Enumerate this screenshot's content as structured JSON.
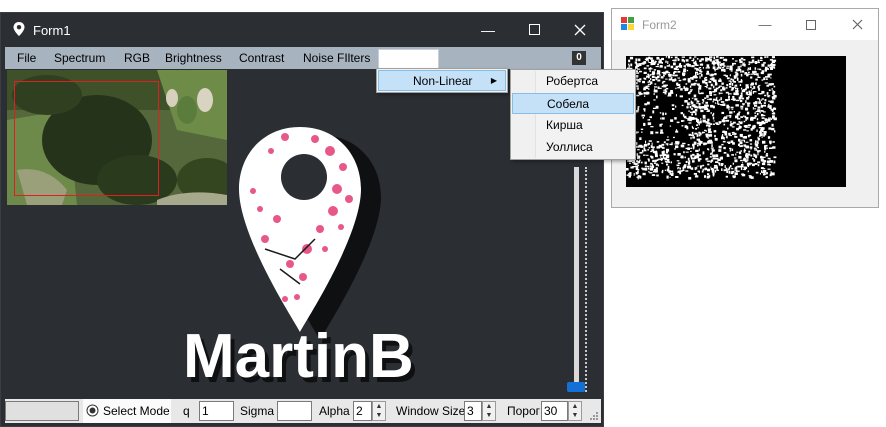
{
  "form1": {
    "title": "Form1",
    "controls": {
      "minimize": "minimize-icon",
      "maximize": "maximize-icon",
      "close": "close-icon"
    },
    "menu": [
      {
        "label": "File"
      },
      {
        "label": "Spectrum"
      },
      {
        "label": "RGB"
      },
      {
        "label": "Brightness"
      },
      {
        "label": "Contrast"
      },
      {
        "label": "Noise FIlters"
      }
    ],
    "menu_counter": "0",
    "logo_text": "MartinB",
    "statusbar": {
      "radio_label": "Select Mode",
      "q_label": "q",
      "q_value": "1",
      "sigma_label": "Sigma",
      "sigma_value": "",
      "alpha_label": "Alpha",
      "alpha_value": "2",
      "window_size_label": "Window Size",
      "window_size_value": "3",
      "threshold_label": "Порог",
      "threshold_value": "30"
    }
  },
  "dropdown": {
    "item": "Non-Linear",
    "submenu": [
      {
        "label": "Робертса",
        "active": false
      },
      {
        "label": "Собела",
        "active": true
      },
      {
        "label": "Кирша",
        "active": false
      },
      {
        "label": "Уоллиса",
        "active": false
      }
    ]
  },
  "form2": {
    "title": "Form2"
  },
  "colors": {
    "form_bg": "#2b2e33",
    "menubar": "#a7b3bf",
    "highlight": "#c5e1f7",
    "slider_thumb": "#1570d6",
    "logo_pink": "#e8578a"
  }
}
